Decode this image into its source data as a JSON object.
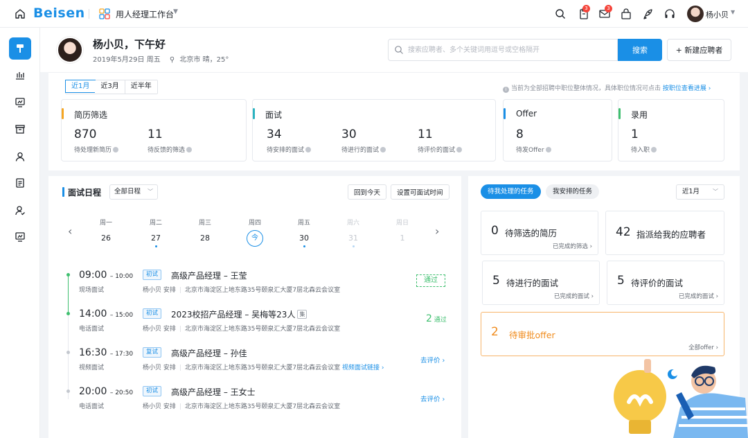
{
  "topbar": {
    "logo": "Beisen",
    "workspace": "用人经理工作台",
    "notifications": {
      "clipboard_badge": "3",
      "mail_badge": "3"
    },
    "user_name": "杨小贝"
  },
  "hero": {
    "greeting": "杨小贝，下午好",
    "date": "2019年5月29日 周五",
    "weather": "北京市 晴，25°",
    "search_placeholder": "搜索应聘者、多个关键词用逗号或空格隔开",
    "search_button": "搜索",
    "new_button": "+ 新建应聘者"
  },
  "stats": {
    "ranges": [
      "近1月",
      "近3月",
      "近半年"
    ],
    "note": "当前为全部招聘中职位整体情况，具体职位情况可点击",
    "note_link": "按职位查看进展 ›",
    "cards": [
      {
        "title": "简历筛选",
        "color": "#f5a623",
        "items": [
          {
            "value": "870",
            "label": "待处理新简历"
          },
          {
            "value": "11",
            "label": "待反馈的筛选"
          }
        ]
      },
      {
        "title": "面试",
        "color": "#2bb3c0",
        "items": [
          {
            "value": "34",
            "label": "待安排的面试"
          },
          {
            "value": "30",
            "label": "待进行的面试"
          },
          {
            "value": "11",
            "label": "待评价的面试"
          }
        ]
      },
      {
        "title": "Offer",
        "color": "#1a8fe6",
        "items": [
          {
            "value": "8",
            "label": "待发Offer"
          }
        ]
      },
      {
        "title": "录用",
        "color": "#3fbf6f",
        "items": [
          {
            "value": "1",
            "label": "待入职"
          }
        ]
      }
    ]
  },
  "schedule": {
    "title": "面试日程",
    "filter": "全部日程",
    "today_button": "回到今天",
    "set_time_button": "设置可面试时间",
    "days": [
      {
        "weekday": "周一",
        "date": "26",
        "dot": false,
        "weekend": false,
        "today": false
      },
      {
        "weekday": "周二",
        "date": "27",
        "dot": true,
        "weekend": false,
        "today": false
      },
      {
        "weekday": "周三",
        "date": "28",
        "dot": false,
        "weekend": false,
        "today": false
      },
      {
        "weekday": "周四",
        "date": "今",
        "dot": false,
        "weekend": false,
        "today": true
      },
      {
        "weekday": "周五",
        "date": "30",
        "dot": true,
        "weekend": false,
        "today": false
      },
      {
        "weekday": "周六",
        "date": "31",
        "dot": true,
        "weekend": true,
        "today": false
      },
      {
        "weekday": "周日",
        "date": "1",
        "dot": false,
        "weekend": true,
        "today": false
      }
    ],
    "interviews": [
      {
        "start": "09:00",
        "end": "10:00",
        "type": "现场面试",
        "round": "初试",
        "title": "高级产品经理 – 王莹",
        "group": "",
        "arranger": "杨小贝 安排",
        "location": "北京市海淀区上地东路35号颐泉汇大厦7层北森云会议室",
        "link": "",
        "status_stamp": "通过",
        "pass_count": "",
        "pass_label": "",
        "action": ""
      },
      {
        "start": "14:00",
        "end": "15:00",
        "type": "电话面试",
        "round": "初试",
        "title": "2023校招产品经理 – 吴梅等23人",
        "group": "集",
        "arranger": "杨小贝 安排",
        "location": "北京市海淀区上地东路35号颐泉汇大厦7层北森云会议室",
        "link": "",
        "status_stamp": "",
        "pass_count": "2",
        "pass_label": "通过",
        "action": ""
      },
      {
        "start": "16:30",
        "end": "17:30",
        "type": "视频面试",
        "round": "复试",
        "title": "高级产品经理 – 孙佳",
        "group": "",
        "arranger": "杨小贝 安排",
        "location": "北京市海淀区上地东路35号颐泉汇大厦7层北森云会议室",
        "link": "视频面试链接 ›",
        "status_stamp": "",
        "pass_count": "",
        "pass_label": "",
        "action": "去评价 ›"
      },
      {
        "start": "20:00",
        "end": "20:50",
        "type": "电话面试",
        "round": "初试",
        "title": "高级产品经理 – 王女士",
        "group": "",
        "arranger": "杨小贝 安排",
        "location": "北京市海淀区上地东路35号颐泉汇大厦7层北森云会议室",
        "link": "",
        "status_stamp": "",
        "pass_count": "",
        "pass_label": "",
        "action": "去评价 ›"
      }
    ]
  },
  "tasks": {
    "tab_mine": "待我处理的任务",
    "tab_arranged": "我安排的任务",
    "range": "近1月",
    "cards": [
      {
        "value": "0",
        "label": "待筛选的简历",
        "sub": "已完成的筛选 ›"
      },
      {
        "value": "42",
        "label": "指派给我的应聘者",
        "sub": ""
      },
      {
        "value": "5",
        "label": "待进行的面试",
        "sub": "已完成的面试 ›"
      },
      {
        "value": "5",
        "label": "待评价的面试",
        "sub": "已完成的面试 ›"
      },
      {
        "value": "2",
        "label": "待审批offer",
        "sub": "全部offer ›"
      }
    ]
  },
  "colors": {
    "primary": "#1a8fe6",
    "success": "#3fbf6f",
    "warning": "#f08c1e",
    "badge": "#f5463c"
  },
  "icons": [
    "home-icon",
    "apps-icon",
    "search-icon",
    "clipboard-icon",
    "mail-icon",
    "bag-icon",
    "rocket-icon",
    "headset-icon",
    "location-pin-icon"
  ]
}
